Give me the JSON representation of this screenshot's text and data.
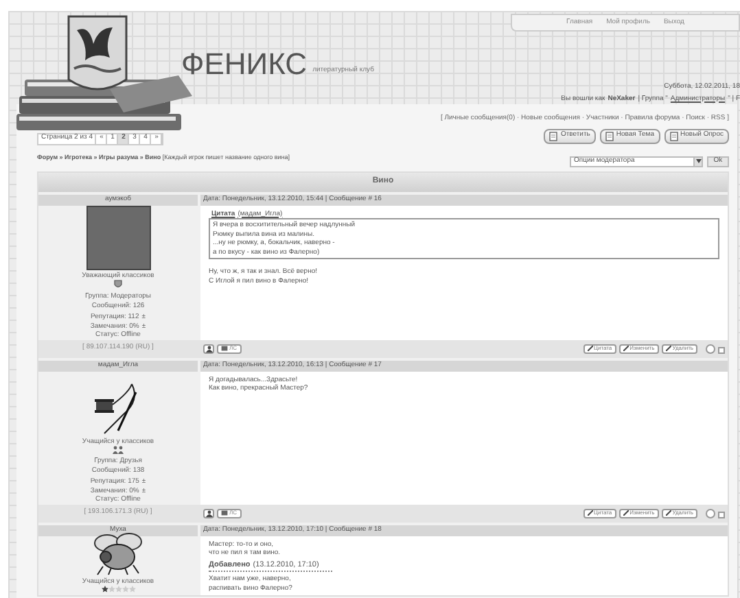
{
  "header": {
    "nav": [
      "Главная",
      "Мой профиль",
      "Выход"
    ],
    "site_title": "ФЕНИКС",
    "site_subtitle": "литературный клуб",
    "date": "Суббота, 12.02.2011, 18",
    "login_prefix": "Вы вошли как",
    "user": "NeXaker",
    "group_prefix": "| Группа \"",
    "group": "Администраторы",
    "group_suffix": "\" | F"
  },
  "top_links": "[ Личные сообщения(0) · Новые сообщения · Участники · Правила форума · Поиск · RSS ]",
  "pagination": {
    "label": "Страница 2 из 4",
    "pages": [
      {
        "label": "«",
        "selected": false
      },
      {
        "label": "1",
        "selected": false
      },
      {
        "label": "2",
        "selected": true
      },
      {
        "label": "3",
        "selected": false
      },
      {
        "label": "4",
        "selected": false
      },
      {
        "label": "»",
        "selected": false
      }
    ]
  },
  "breadcrumb": "**Форум » Игротека » Игры разума » Вино** [Каждый игрок пишет название одного вина]",
  "action_buttons": [
    "Ответить",
    "Новая Тема",
    "Новый Опрос"
  ],
  "moderator_select": {
    "value": "Опции модератора",
    "button": "Ok"
  },
  "topic_title": "Вино",
  "posts": [
    {
      "author": "аумэкоб",
      "avatar": {
        "kind": "photo"
      },
      "rank": "Уважающий классиков",
      "rank_mark": {
        "kind": "shield"
      },
      "group": "Группа: Модераторы",
      "messages": "Сообщений: 126",
      "reputation": "Репутация: 112",
      "reputation_sign": "±",
      "warnings": "Замечания: 0%",
      "warnings_sign": "±",
      "status": "Статус: Offline",
      "meta": "Дата: Понедельник, 13.12.2010, 15:44 | Сообщение # 16",
      "body": [
        {
          "kind": "quote",
          "title": "Цитата",
          "source": "(мадам_Игла)",
          "lines": [
            "Я вчера в восхитительный вечер надлунный",
            "Рюмку выпила вина из малины.",
            "...ну не рюмку, а, бокальчик, наверно -",
            "а по вкусу - как вино из Фалерно)"
          ]
        },
        {
          "kind": "text",
          "lines": [
            "Ну, что ж, я так и знал. Всё верно!",
            "С Иглой я пил вино в Фалерно!"
          ]
        }
      ],
      "footer": {
        "ip": "[ 89.107.114.190 (RU) ]",
        "pm": "ЛС",
        "actions": [
          "Цитата",
          "Изменить",
          "Удалить"
        ],
        "checked": false
      }
    },
    {
      "author": "мадам_Игла",
      "avatar": {
        "kind": "needle"
      },
      "rank": "Учащийся у классиков",
      "rank_mark": {
        "kind": "people"
      },
      "group": "Группа: Друзья",
      "messages": "Сообщений: 138",
      "reputation": "Репутация: 175",
      "reputation_sign": "±",
      "warnings": "Замечания: 0%",
      "warnings_sign": "±",
      "status": "Статус: Offline",
      "meta": "Дата: Понедельник, 13.12.2010, 16:13 | Сообщение # 17",
      "body": [
        {
          "kind": "text",
          "lines": [
            "Я догадывалась...Здрасьте!",
            "Как вино, прекрасный Мастер?"
          ]
        }
      ],
      "footer": {
        "ip": "[ 193.106.171.3 (RU) ]",
        "pm": "ЛС",
        "actions": [
          "Цитата",
          "Изменить",
          "Удалить"
        ],
        "checked": false
      }
    },
    {
      "author": "Муха",
      "avatar": {
        "kind": "fly"
      },
      "rank": "Учащийся у классиков",
      "rank_mark": {
        "kind": "stars"
      },
      "stars": 1,
      "meta": "Дата: Понедельник, 13.12.2010, 17:10 | Сообщение # 18",
      "body": [
        {
          "kind": "text",
          "lines": [
            "Мастер: то-то и оно,",
            "что не пил я там вино."
          ]
        },
        {
          "kind": "added",
          "label": "Добавлено",
          "time": "(13.12.2010, 17:10)"
        },
        {
          "kind": "text",
          "lines": [
            "Хватит нам уже, наверно,",
            "распивать вино Фалерно?"
          ]
        }
      ]
    }
  ]
}
